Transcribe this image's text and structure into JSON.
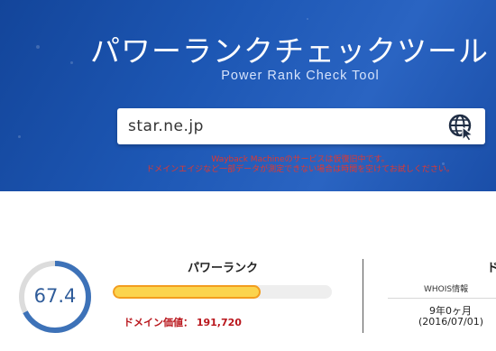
{
  "header": {
    "title": "パワーランクチェックツール",
    "subtitle": "Power Rank Check Tool"
  },
  "search": {
    "value": "star.ne.jp",
    "button_icon": "globe-cursor-icon"
  },
  "notices": [
    "Wayback Machineのサービスは仮復旧中です。",
    "ドメインエイジなど一部データが測定できない場合は時間を空けてお試しください。"
  ],
  "results": {
    "score": "67.4",
    "score_fraction": 0.674,
    "power_rank_label": "パワーランク",
    "power_rank_fill": 0.674,
    "domain_value_text": "ドメイン価値： 191,720",
    "right_heading": "ド",
    "whois_label": "WHOIS情報",
    "age_text": "9年0ヶ月",
    "age_date": "(2016/07/01)"
  },
  "colors": {
    "header_bg": "#1d57b4",
    "notice_red": "#e2372f",
    "gauge_blue": "#3d72b8",
    "gauge_track": "#dcdcdc",
    "bar_fill": "#fbd44e",
    "bar_border": "#f39d1f",
    "domain_value_red": "#b9161c"
  }
}
